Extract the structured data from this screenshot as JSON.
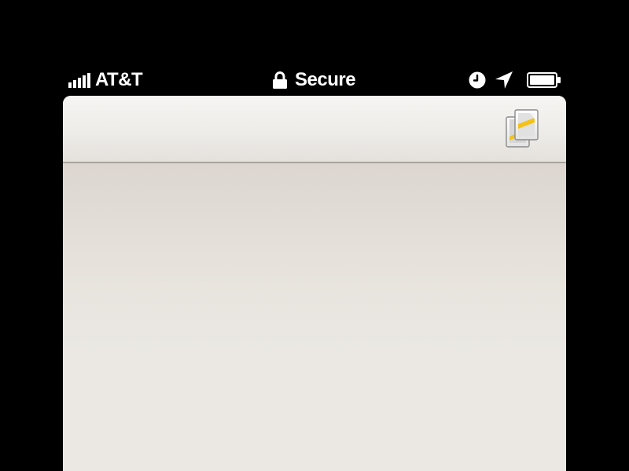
{
  "status_bar": {
    "carrier": "AT&T",
    "signal_bars": 5,
    "secure_label": "Secure",
    "icons": [
      "signal-icon",
      "lock-icon",
      "alarm-clock-icon",
      "location-arrow-icon",
      "battery-icon"
    ],
    "battery_level": 1.0
  },
  "toolbar": {
    "pages_icon": "pages-icon"
  },
  "colors": {
    "status_bar_bg": "#000000",
    "status_text": "#ffffff",
    "toolbar_bg": "#f1efec",
    "content_bg": "#ebe8e3",
    "accent_yellow": "#f2c21a"
  }
}
